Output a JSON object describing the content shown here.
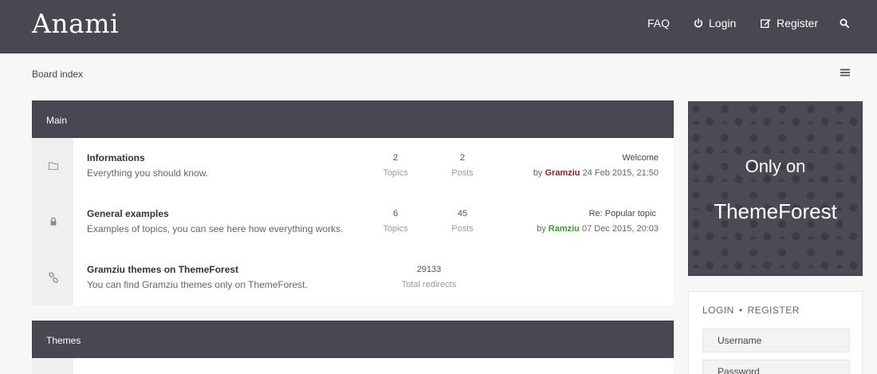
{
  "header": {
    "logo": "Anami",
    "nav": {
      "faq": "FAQ",
      "login": "Login",
      "register": "Register"
    }
  },
  "breadcrumb": "Board index",
  "categories": [
    {
      "title": "Main",
      "forums": [
        {
          "title": "Informations",
          "desc": "Everything you should know.",
          "topics": "2",
          "topics_label": "Topics",
          "posts": "2",
          "posts_label": "Posts",
          "last_title": "Welcome",
          "last_by": "by",
          "last_user": "Gramziu",
          "last_date": "24 Feb 2015, 21:50",
          "icon": "folder-icon"
        },
        {
          "title": "General examples",
          "desc": "Examples of topics, you can see here how everything works.",
          "topics": "6",
          "topics_label": "Topics",
          "posts": "45",
          "posts_label": "Posts",
          "last_title": "Re: Popular topic",
          "last_by": "by",
          "last_user": "Ramziu",
          "last_date": "07 Dec 2015, 20:03",
          "icon": "lock-icon"
        },
        {
          "title": "Gramziu themes on ThemeForest",
          "desc": "You can find Gramziu themes only on ThemeForest.",
          "redirects": "29133",
          "redirects_label": "Total redirects",
          "icon": "link-icon"
        }
      ]
    },
    {
      "title": "Themes",
      "forums": []
    }
  ],
  "sidebar": {
    "promo_line1": "Only on",
    "promo_line2": "ThemeForest",
    "login_tab": "LOGIN",
    "separator": "•",
    "register_tab": "REGISTER",
    "username_placeholder": "Username",
    "password_placeholder": "Password"
  },
  "colors": {
    "header_bg": "#474851",
    "user_red": "#8a2323",
    "user_green": "#3d9a2e"
  }
}
